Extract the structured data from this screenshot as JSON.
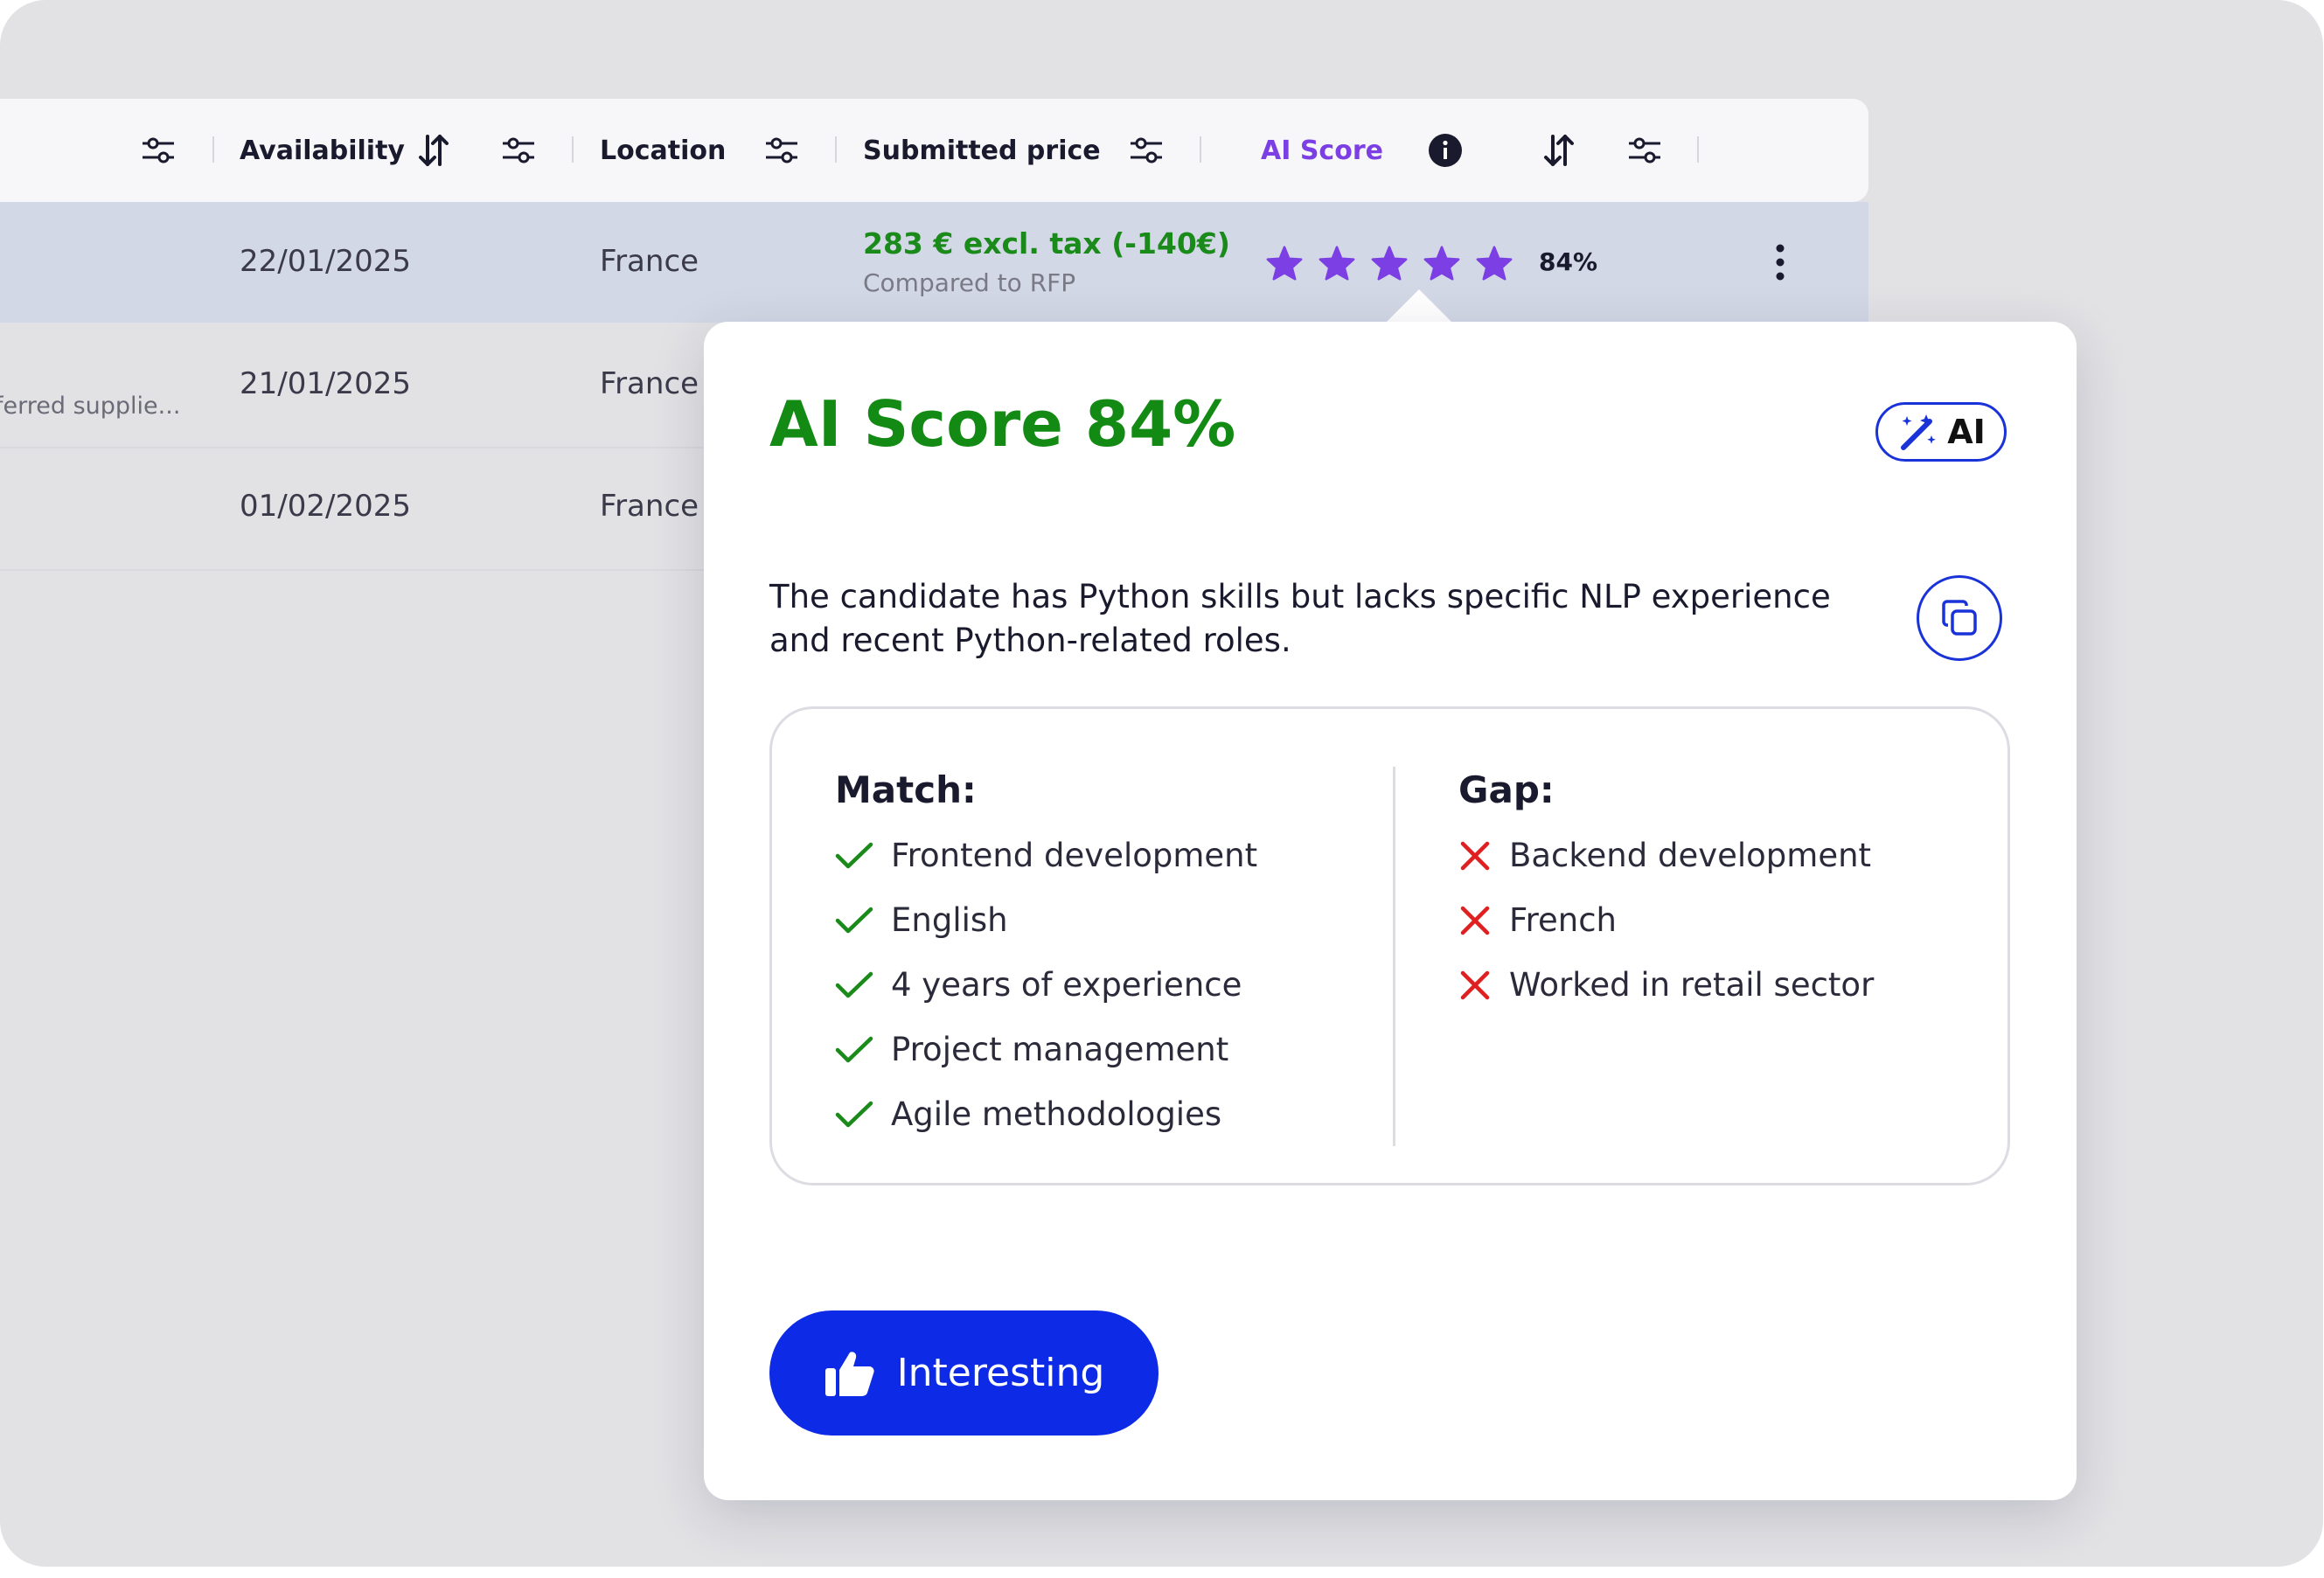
{
  "table": {
    "headers": {
      "availability": "Availability",
      "location": "Location",
      "submitted_price": "Submitted price",
      "ai_score": "AI Score"
    },
    "rows": [
      {
        "availability": "22/01/2025",
        "location": "France",
        "price": "283 € excl. tax (-140€)",
        "price_note": "Compared to RFP",
        "stars": 5,
        "ai_score": "84%"
      },
      {
        "supplier_note": "ferred supplie...",
        "availability": "21/01/2025",
        "location": "France"
      },
      {
        "availability": "01/02/2025",
        "location": "France"
      }
    ]
  },
  "popup": {
    "title": "AI Score 84%",
    "badge": "AI",
    "summary": "The candidate has Python skills but lacks specific NLP experience and recent Python-related roles.",
    "match_title": "Match:",
    "match": [
      "Frontend development",
      "English",
      "4 years of experience",
      "Project management",
      "Agile methodologies"
    ],
    "gap_title": "Gap:",
    "gap": [
      "Backend development",
      "French",
      "Worked in retail sector"
    ],
    "cta_label": "Interesting"
  },
  "colors": {
    "accent_blue": "#0d2be6",
    "score_green": "#138a13",
    "star_purple": "#7b3fe4",
    "gap_red": "#e02020"
  },
  "icons": [
    "filter-icon",
    "sort-icon",
    "info-icon",
    "more-vertical-icon",
    "star-icon",
    "magic-wand-icon",
    "copy-icon",
    "check-icon",
    "x-icon",
    "thumbs-up-icon"
  ]
}
